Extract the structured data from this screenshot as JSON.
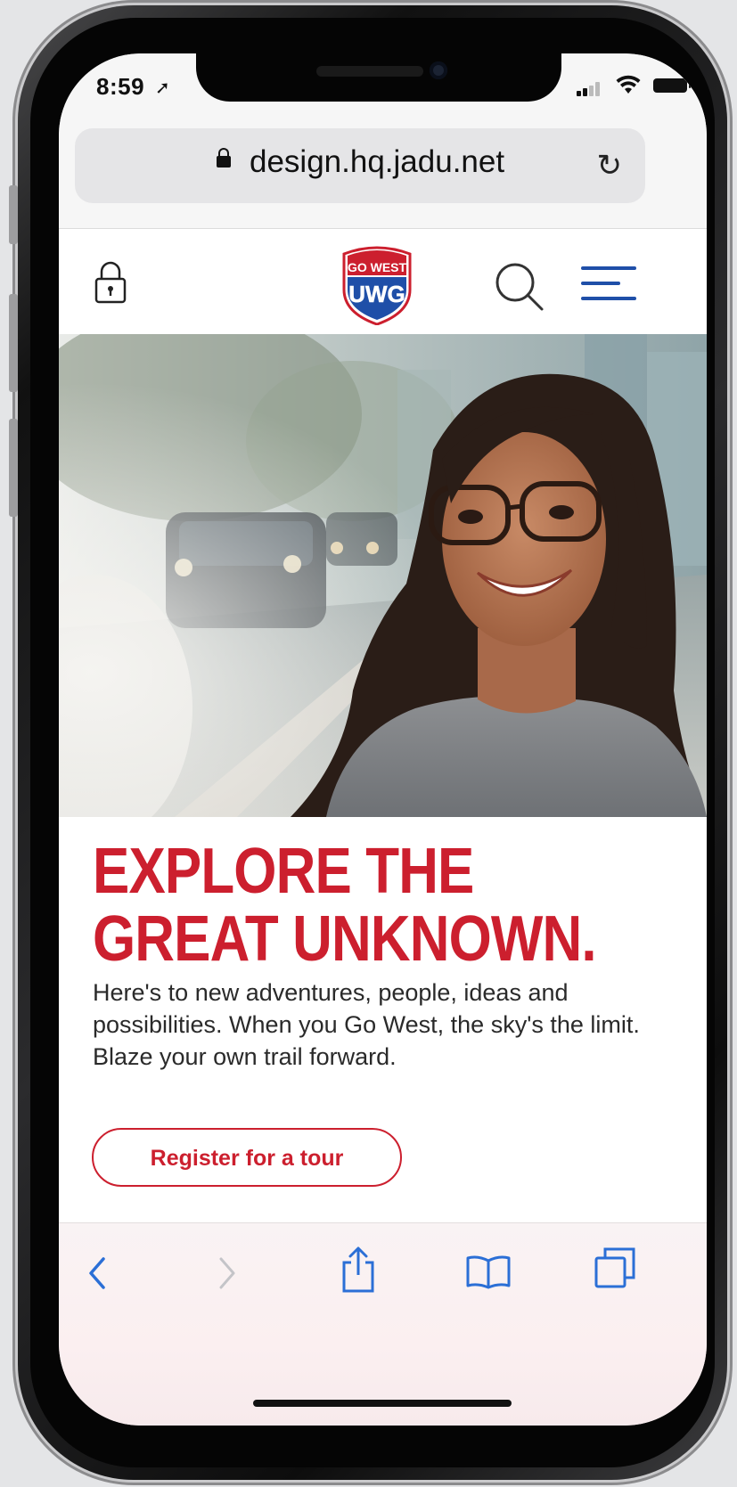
{
  "status_bar": {
    "time": "8:59"
  },
  "browser": {
    "url": "design.hq.jadu.net"
  },
  "site_header": {
    "logo_top_text": "GO WEST",
    "logo_main_text": "UWG",
    "brand_red": "#cc1f2e",
    "brand_blue": "#1f4fa8"
  },
  "hero": {
    "headline_line1": "EXPLORE THE",
    "headline_line2": "GREAT UNKNOWN.",
    "body": "Here's to new adventures, people, ideas and possibilities. When you Go West, the sky's the limit. Blaze your own trail forward.",
    "cta_label": "Register for a tour"
  },
  "icons": {
    "header": [
      "lock-icon",
      "search-icon",
      "hamburger-menu-icon"
    ],
    "toolbar": [
      "back-icon",
      "forward-icon",
      "share-icon",
      "bookmarks-icon",
      "tabs-icon"
    ]
  }
}
